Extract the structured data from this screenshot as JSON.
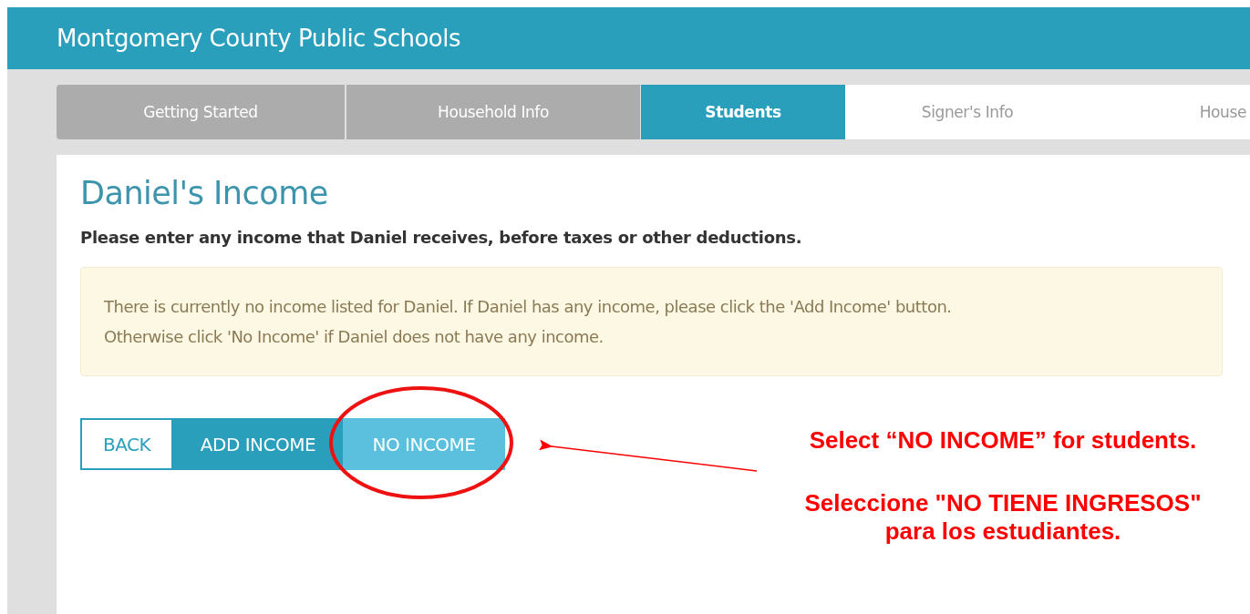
{
  "header": {
    "title": "Montgomery County Public Schools"
  },
  "tabs": [
    {
      "label": "Getting Started",
      "selected": false,
      "completed": true
    },
    {
      "label": "Household Info",
      "selected": false,
      "completed": true
    },
    {
      "label": "Students",
      "selected": true,
      "completed": false
    },
    {
      "label": "Signer's Info",
      "selected": false,
      "completed": false
    },
    {
      "label": "House",
      "selected": false,
      "completed": false
    }
  ],
  "page": {
    "heading": "Daniel's Income",
    "instruction": "Please enter any income that Daniel receives, before taxes or other deductions.",
    "alert_lines": [
      "There is currently no income listed for Daniel. If Daniel has any income, please click the 'Add Income' button.",
      "Otherwise click 'No Income' if Daniel does not have any income."
    ],
    "buttons": [
      {
        "label": "BACK",
        "kind": "outline"
      },
      {
        "label": "ADD INCOME",
        "kind": "primary"
      },
      {
        "label": "NO INCOME",
        "kind": "light"
      }
    ]
  },
  "annotation": {
    "lines": [
      "Select “NO INCOME” for students.",
      "Seleccione \"NO TIENE INGRESOS\"",
      "para los estudiantes."
    ]
  }
}
